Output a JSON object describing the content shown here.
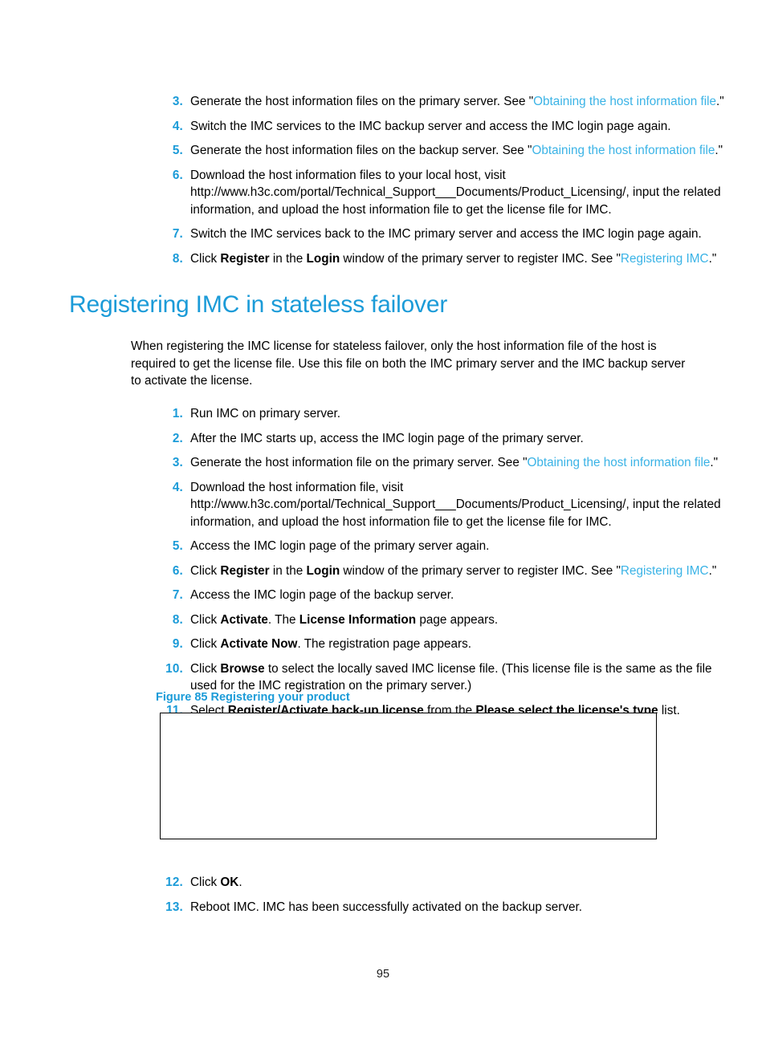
{
  "page": {
    "number": "95"
  },
  "colors": {
    "heading_blue": "#1b9bd8",
    "number_blue": "#1b9bd8",
    "link_blue": "#3ab3e6",
    "body_black": "#000000",
    "figure_border": "#000000"
  },
  "top_steps": [
    {
      "number": "3.",
      "parts": [
        {
          "type": "text",
          "value": "Generate the host information files on the primary server. See \""
        },
        {
          "type": "link",
          "value": "Obtaining the host information file"
        },
        {
          "type": "text",
          "value": ".\""
        }
      ]
    },
    {
      "number": "4.",
      "parts": [
        {
          "type": "text",
          "value": "Switch the IMC services to the IMC backup server and access the IMC login page again."
        }
      ]
    },
    {
      "number": "5.",
      "parts": [
        {
          "type": "text",
          "value": "Generate the host information files on the backup server. See \""
        },
        {
          "type": "link",
          "value": "Obtaining the host information file"
        },
        {
          "type": "text",
          "value": ".\""
        }
      ]
    },
    {
      "number": "6.",
      "parts": [
        {
          "type": "text",
          "value": "Download the host information files to your local host, visit http://www.h3c.com/portal/Technical_Support___Documents/Product_Licensing/, input the related information, and upload the host information file to get the license file for IMC."
        }
      ]
    },
    {
      "number": "7.",
      "parts": [
        {
          "type": "text",
          "value": "Switch the IMC services back to the IMC primary server and access the IMC login page again."
        }
      ]
    },
    {
      "number": "8.",
      "parts": [
        {
          "type": "text",
          "value": "Click "
        },
        {
          "type": "bold",
          "value": "Register"
        },
        {
          "type": "text",
          "value": " in the "
        },
        {
          "type": "bold",
          "value": "Login"
        },
        {
          "type": "text",
          "value": " window of the primary server to register IMC. See \""
        },
        {
          "type": "link",
          "value": "Registering IMC"
        },
        {
          "type": "text",
          "value": ".\""
        }
      ]
    }
  ],
  "section": {
    "heading": "Registering IMC in stateless failover",
    "intro": "When registering the IMC license for stateless failover, only the host information file of the host is required to get the license file. Use this file on both the IMC primary server and the IMC backup server to activate the license."
  },
  "main_steps": [
    {
      "number": "1.",
      "parts": [
        {
          "type": "text",
          "value": "Run IMC on primary server."
        }
      ]
    },
    {
      "number": "2.",
      "parts": [
        {
          "type": "text",
          "value": "After the IMC starts up, access the IMC login page of the primary server."
        }
      ]
    },
    {
      "number": "3.",
      "parts": [
        {
          "type": "text",
          "value": "Generate the host information file on the primary server. See \""
        },
        {
          "type": "link",
          "value": "Obtaining the host information file"
        },
        {
          "type": "text",
          "value": ".\""
        }
      ]
    },
    {
      "number": "4.",
      "parts": [
        {
          "type": "text",
          "value": "Download the host information file, visit http://www.h3c.com/portal/Technical_Support___Documents/Product_Licensing/, input the related information, and upload the host information file to get the license file for IMC."
        }
      ]
    },
    {
      "number": "5.",
      "parts": [
        {
          "type": "text",
          "value": "Access the IMC login page of the primary server again."
        }
      ]
    },
    {
      "number": "6.",
      "parts": [
        {
          "type": "text",
          "value": "Click "
        },
        {
          "type": "bold",
          "value": "Register"
        },
        {
          "type": "text",
          "value": " in the "
        },
        {
          "type": "bold",
          "value": "Login"
        },
        {
          "type": "text",
          "value": " window of the primary server to register IMC. See \""
        },
        {
          "type": "link",
          "value": "Registering IMC"
        },
        {
          "type": "text",
          "value": ".\""
        }
      ]
    },
    {
      "number": "7.",
      "parts": [
        {
          "type": "text",
          "value": "Access the IMC login page of the backup server."
        }
      ]
    },
    {
      "number": "8.",
      "parts": [
        {
          "type": "text",
          "value": "Click "
        },
        {
          "type": "bold",
          "value": "Activate"
        },
        {
          "type": "text",
          "value": ". The "
        },
        {
          "type": "bold",
          "value": "License Information"
        },
        {
          "type": "text",
          "value": " page appears."
        }
      ]
    },
    {
      "number": "9.",
      "parts": [
        {
          "type": "text",
          "value": "Click "
        },
        {
          "type": "bold",
          "value": "Activate Now"
        },
        {
          "type": "text",
          "value": ". The registration page appears."
        }
      ]
    },
    {
      "number": "10.",
      "parts": [
        {
          "type": "text",
          "value": "Click "
        },
        {
          "type": "bold",
          "value": "Browse"
        },
        {
          "type": "text",
          "value": " to select the locally saved IMC license file. (This license file is the same as the file used for the IMC registration on the primary server.)"
        }
      ]
    },
    {
      "number": "11.",
      "parts": [
        {
          "type": "text",
          "value": "Select "
        },
        {
          "type": "bold",
          "value": "Register/Activate back-up license"
        },
        {
          "type": "text",
          "value": " from the "
        },
        {
          "type": "bold",
          "value": "Please select the license's type"
        },
        {
          "type": "text",
          "value": " list."
        }
      ]
    }
  ],
  "figure": {
    "caption": "Figure 85 Registering your product",
    "content": ""
  },
  "tail_steps": [
    {
      "number": "12.",
      "parts": [
        {
          "type": "text",
          "value": "Click "
        },
        {
          "type": "bold",
          "value": "OK"
        },
        {
          "type": "text",
          "value": "."
        }
      ]
    },
    {
      "number": "13.",
      "parts": [
        {
          "type": "text",
          "value": "Reboot IMC. IMC has been successfully activated on the backup server."
        }
      ]
    }
  ]
}
